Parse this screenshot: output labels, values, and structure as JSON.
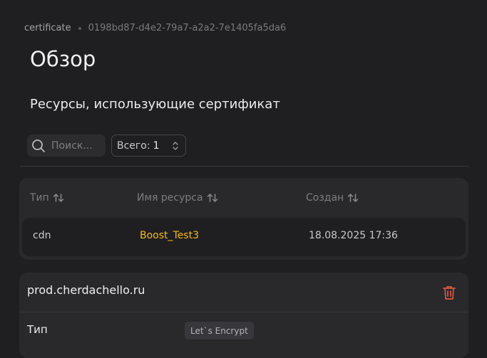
{
  "breadcrumb": {
    "parent": "certificate",
    "id": "0198bd87-d4e2-79a7-a2a2-7e1405fa5da6"
  },
  "page": {
    "title": "Обзор"
  },
  "section": {
    "title": "Ресурсы, использующие сертификат"
  },
  "search": {
    "placeholder": "Поиск..."
  },
  "total": {
    "label": "Всего:",
    "value": "1"
  },
  "table": {
    "columns": [
      {
        "label": "Тип"
      },
      {
        "label": "Имя ресурса"
      },
      {
        "label": "Создан"
      }
    ],
    "rows": [
      {
        "type": "cdn",
        "name": "Boost_Test3",
        "created": "18.08.2025 17:36"
      }
    ]
  },
  "certificate": {
    "domain": "prod.cherdachello.ru",
    "properties": [
      {
        "label": "Тип",
        "value": "Let`s Encrypt"
      }
    ]
  },
  "colors": {
    "accent_link": "#f5b90f",
    "danger_icon": "#e0553f",
    "background": "#1f1f21",
    "card": "#29292c"
  },
  "icons": {
    "search": "search-icon",
    "sort": "sort-icon",
    "stepper": "chevron-updown-icon",
    "delete": "trash-icon"
  }
}
